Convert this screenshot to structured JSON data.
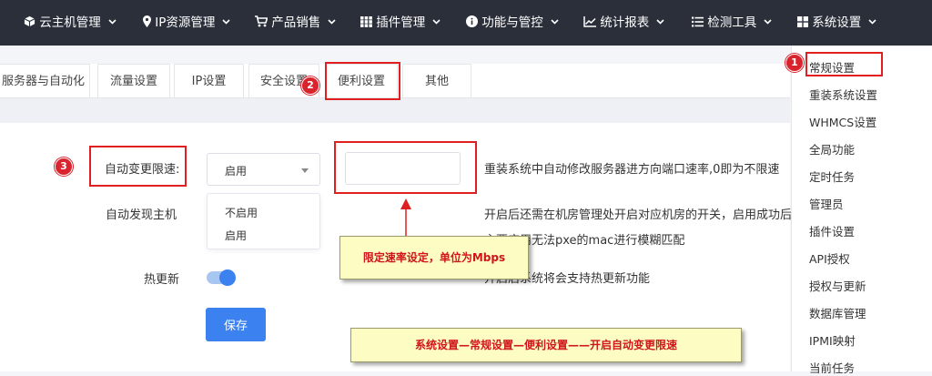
{
  "topnav": {
    "items": [
      {
        "label": "云主机管理",
        "icon": "cube-icon"
      },
      {
        "label": "IP资源管理",
        "icon": "map-pin-icon"
      },
      {
        "label": "产品销售",
        "icon": "cart-icon"
      },
      {
        "label": "插件管理",
        "icon": "grid-icon"
      },
      {
        "label": "功能与管控",
        "icon": "info-icon"
      },
      {
        "label": "统计报表",
        "icon": "chart-line-icon"
      },
      {
        "label": "检测工具",
        "icon": "list-icon"
      },
      {
        "label": "系统设置",
        "icon": "apps-icon"
      }
    ]
  },
  "tabs": [
    "服务器与自动化",
    "流量设置",
    "IP设置",
    "安全设置",
    "便利设置",
    "其他"
  ],
  "form": {
    "auto_limit_label": "自动变更限速:",
    "auto_limit_value": "启用",
    "auto_limit_options": [
      "不启用",
      "启用"
    ],
    "auto_limit_hint": "重装系统中自动修改服务器进方向端口速率,0即为不限速",
    "speed_input_value": "",
    "auto_discover_label": "自动发现主机",
    "auto_discover_hint1": "开启后还需在机房管理处开启对应机房的开关，启用成功后",
    "auto_discover_hint2": "主要应用无法pxe的mac进行模糊匹配",
    "hot_update_label": "热更新",
    "hot_update_on": true,
    "hot_update_hint": "开启后系统将会支持热更新功能",
    "save_label": "保存"
  },
  "menu": {
    "items": [
      "常规设置",
      "重装系统设置",
      "WHMCS设置",
      "全局功能",
      "定时任务",
      "管理员",
      "插件设置",
      "API授权",
      "授权与更新",
      "数据库管理",
      "IPMI映射",
      "当前任务"
    ]
  },
  "annotations": {
    "badge1": "1",
    "badge2": "2",
    "badge3": "3",
    "callout_speed": "限定速率设定，单位为Mbps",
    "callout_path": "系统设置—常规设置—便利设置——开启自动变更限速"
  },
  "colors": {
    "topbar": "#2b2f3a",
    "primary": "#3b82f0",
    "annotation_red": "#e02020",
    "callout_bg": "#fdfcc2"
  }
}
